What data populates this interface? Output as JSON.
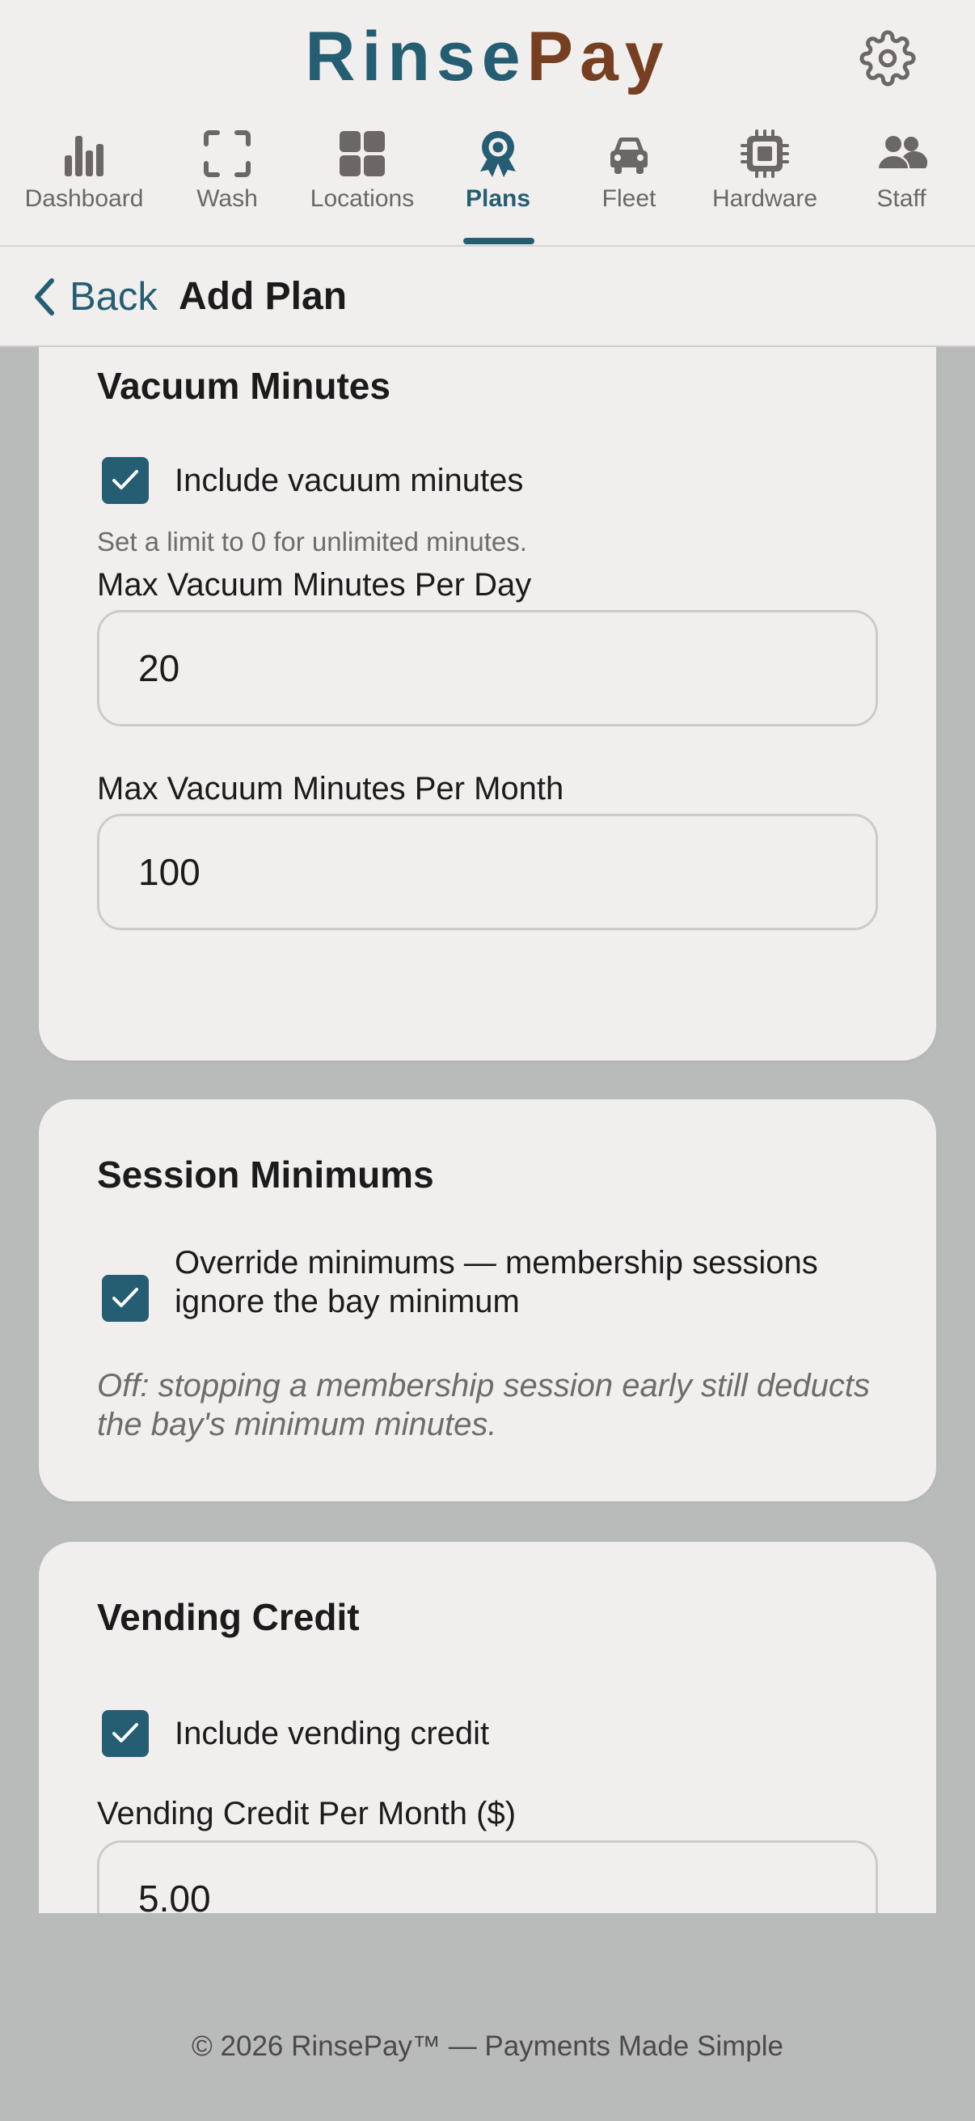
{
  "header": {
    "logo_part1": "Rinse",
    "logo_part2": "Pay",
    "settings_icon": "gear-icon"
  },
  "nav": {
    "items": [
      {
        "label": "Dashboard",
        "icon": "bar-chart-icon",
        "active": false
      },
      {
        "label": "Wash",
        "icon": "scan-frame-icon",
        "active": false
      },
      {
        "label": "Locations",
        "icon": "grid-icon",
        "active": false
      },
      {
        "label": "Plans",
        "icon": "award-badge-icon",
        "active": true
      },
      {
        "label": "Fleet",
        "icon": "car-icon",
        "active": false
      },
      {
        "label": "Hardware",
        "icon": "chip-icon",
        "active": false
      },
      {
        "label": "Staff",
        "icon": "users-icon",
        "active": false
      }
    ]
  },
  "subheader": {
    "back_label": "Back",
    "title": "Add Plan"
  },
  "vacuum": {
    "title": "Vacuum Minutes",
    "include_label": "Include vacuum minutes",
    "include_checked": true,
    "hint": "Set a limit to 0 for unlimited minutes.",
    "per_day_label": "Max Vacuum Minutes Per Day",
    "per_day_value": "20",
    "per_month_label": "Max Vacuum Minutes Per Month",
    "per_month_value": "100"
  },
  "session": {
    "title": "Session Minimums",
    "override_label": "Override minimums — membership sessions ignore the bay minimum",
    "override_checked": true,
    "note": "Off: stopping a membership session early still deducts the bay's minimum minutes."
  },
  "vending": {
    "title": "Vending Credit",
    "include_label": "Include vending credit",
    "include_checked": true,
    "per_month_label": "Vending Credit Per Month ($)",
    "per_month_value": "5.00"
  },
  "footer": {
    "text": "© 2026 RinsePay™ — Payments Made Simple"
  },
  "colors": {
    "brand_teal": "#255d73",
    "brand_brown": "#773f22",
    "background": "#b9baba",
    "surface": "#f1efee"
  }
}
